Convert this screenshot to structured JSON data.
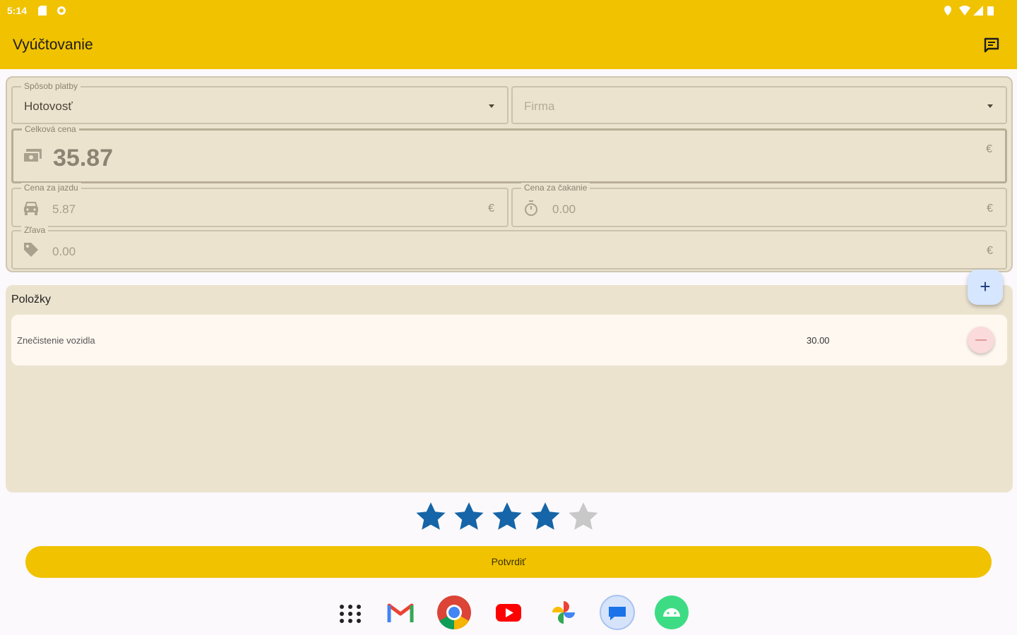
{
  "status_bar": {
    "time": "5:14"
  },
  "app_bar": {
    "title": "Vyúčtovanie"
  },
  "payment_method": {
    "label": "Spôsob platby",
    "value": "Hotovosť"
  },
  "company": {
    "placeholder": "Firma"
  },
  "total_price": {
    "label": "Celková cena",
    "value": "35.87",
    "currency": "€"
  },
  "ride_price": {
    "label": "Cena za jazdu",
    "value": "5.87",
    "currency": "€"
  },
  "waiting_price": {
    "label": "Cena za čakanie",
    "value": "0.00",
    "currency": "€"
  },
  "discount": {
    "label": "Zľava",
    "value": "0.00",
    "currency": "€"
  },
  "items": {
    "title": "Položky",
    "add_label": "+",
    "rows": [
      {
        "name": "Znečistenie vozidla",
        "price": "30.00"
      }
    ]
  },
  "rating": {
    "value": 4,
    "max": 5,
    "filled_color": "#1565a8",
    "empty_color": "#c8c8c8"
  },
  "confirm": {
    "label": "Potvrdiť"
  },
  "dock": [
    "apps-grid-icon",
    "gmail-icon",
    "chrome-icon",
    "youtube-icon",
    "photos-icon",
    "messages-icon",
    "android-icon"
  ],
  "colors": {
    "accent": "#f0c200",
    "card": "#ece3cf"
  }
}
